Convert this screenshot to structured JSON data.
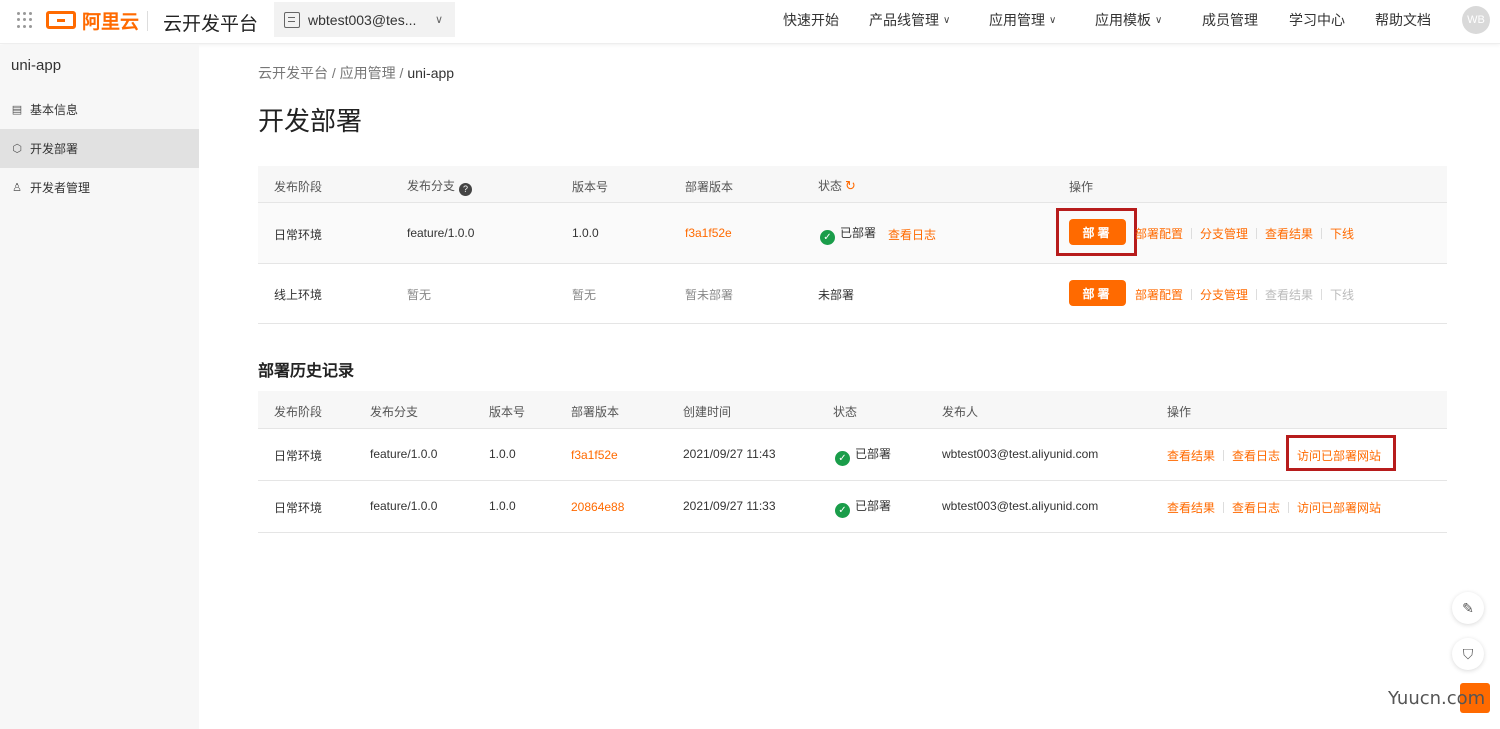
{
  "topbar": {
    "logo_text": "阿里云",
    "platform_title": "云开发平台",
    "account": "wbtest003@tes...",
    "nav": [
      {
        "label": "快速开始",
        "caret": false
      },
      {
        "label": "产品线管理",
        "caret": true
      },
      {
        "label": "应用管理",
        "caret": true
      },
      {
        "label": "应用模板",
        "caret": true
      },
      {
        "label": "成员管理",
        "caret": false
      },
      {
        "label": "学习中心",
        "caret": false
      },
      {
        "label": "帮助文档",
        "caret": false
      }
    ],
    "avatar": "WB"
  },
  "sidebar": {
    "app_name": "uni-app",
    "items": [
      {
        "label": "基本信息",
        "icon": "document-icon"
      },
      {
        "label": "开发部署",
        "icon": "cube-icon"
      },
      {
        "label": "开发者管理",
        "icon": "user-icon"
      }
    ]
  },
  "breadcrumb": {
    "root": "云开发平台",
    "mid": "应用管理",
    "current": "uni-app",
    "sep": " / "
  },
  "page_title": "开发部署",
  "env_table": {
    "headers": [
      "发布阶段",
      "发布分支",
      "版本号",
      "部署版本",
      "状态",
      "操作"
    ],
    "rows": [
      {
        "stage": "日常环境",
        "branch": "feature/1.0.0",
        "version": "1.0.0",
        "deploy_version": "f3a1f52e",
        "status": "已部署",
        "status_link": "查看日志",
        "deploy_btn": "部署",
        "ops": [
          "部署配置",
          "分支管理",
          "查看结果",
          "下线"
        ]
      },
      {
        "stage": "线上环境",
        "branch": "暂无",
        "version": "暂无",
        "deploy_version": "暂未部署",
        "status": "未部署",
        "deploy_btn": "部署",
        "ops": [
          "部署配置",
          "分支管理",
          "查看结果",
          "下线"
        ]
      }
    ]
  },
  "history": {
    "title": "部署历史记录",
    "headers": [
      "发布阶段",
      "发布分支",
      "版本号",
      "部署版本",
      "创建时间",
      "状态",
      "发布人",
      "操作"
    ],
    "rows": [
      {
        "stage": "日常环境",
        "branch": "feature/1.0.0",
        "version": "1.0.0",
        "deploy_version": "f3a1f52e",
        "created": "2021/09/27 11:43",
        "status": "已部署",
        "publisher": "wbtest003@test.aliyunid.com",
        "ops": [
          "查看结果",
          "查看日志",
          "访问已部署网站"
        ]
      },
      {
        "stage": "日常环境",
        "branch": "feature/1.0.0",
        "version": "1.0.0",
        "deploy_version": "20864e88",
        "created": "2021/09/27 11:33",
        "status": "已部署",
        "publisher": "wbtest003@test.aliyunid.com",
        "ops": [
          "查看结果",
          "查看日志",
          "访问已部署网站"
        ]
      }
    ]
  },
  "watermark": "Yuucn.com",
  "colors": {
    "accent": "#ff6a00",
    "success": "#1a9d4a",
    "highlight_box": "#b71c1c"
  }
}
